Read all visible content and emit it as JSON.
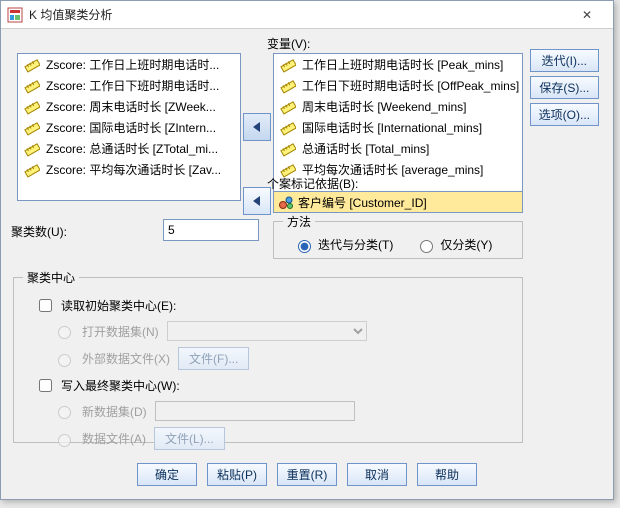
{
  "dialog": {
    "title": "K 均值聚类分析",
    "close_icon": "✕"
  },
  "right_buttons": {
    "iterate": "迭代(I)...",
    "save": "保存(S)...",
    "options": "选项(O)..."
  },
  "labels": {
    "variables": "变量(V):",
    "case_label_by": "个案标记依据(B):",
    "clusters": "聚类数(U):",
    "method": "方法",
    "center_group": "聚类中心",
    "read_initial": "读取初始聚类中心(E):",
    "open_dataset": "打开数据集(N)",
    "external_file": "外部数据文件(X)",
    "file_btn1": "文件(F)...",
    "write_final": "写入最终聚类中心(W):",
    "new_dataset": "新数据集(D)",
    "data_file": "数据文件(A)",
    "file_btn2": "文件(L)..."
  },
  "source_list": [
    "Zscore:  工作日上班时期电话时...",
    "Zscore:  工作日下班时期电话时...",
    "Zscore:  周末电话时长 [ZWeek...",
    "Zscore:  国际电话时长 [ZIntern...",
    "Zscore:  总通话时长 [ZTotal_mi...",
    "Zscore:  平均每次通话时长 [Zav..."
  ],
  "var_list": [
    "工作日上班时期电话时长 [Peak_mins]",
    "工作日下班时期电话时长 [OffPeak_mins]",
    "周末电话时长 [Weekend_mins]",
    "国际电话时长 [International_mins]",
    "总通话时长 [Total_mins]",
    "平均每次通话时长 [average_mins]"
  ],
  "case_field": "客户编号 [Customer_ID]",
  "clusters_value": "5",
  "method": {
    "iter_and_classify": "迭代与分类(T)",
    "classify_only": "仅分类(Y)"
  },
  "bottom": {
    "ok": "确定",
    "paste": "粘贴(P)",
    "reset": "重置(R)",
    "cancel": "取消",
    "help": "帮助"
  }
}
